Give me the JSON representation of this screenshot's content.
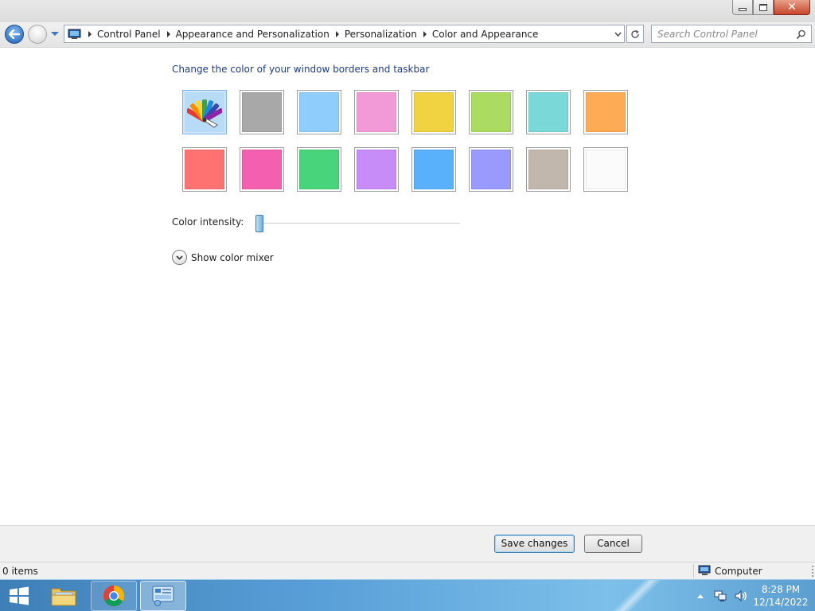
{
  "window": {
    "controls": {
      "minimize": "minimize-icon",
      "maximize": "restore-icon",
      "close": "close-icon"
    }
  },
  "nav": {
    "breadcrumbs": [
      "Control Panel",
      "Appearance and Personalization",
      "Personalization",
      "Color and Appearance"
    ],
    "search_placeholder": "Search Control Panel"
  },
  "main": {
    "heading": "Change the color of your window borders and taskbar",
    "swatches": [
      {
        "name": "custom",
        "color": "#b8dbf8",
        "selected": true,
        "icon": "color-palette-icon"
      },
      {
        "name": "slate",
        "color": "#a8a8a8"
      },
      {
        "name": "sky",
        "color": "#8ecdfc"
      },
      {
        "name": "twilight",
        "color": "#f29ad7"
      },
      {
        "name": "sun",
        "color": "#f1d240"
      },
      {
        "name": "leaf",
        "color": "#abdc61"
      },
      {
        "name": "sea-foam",
        "color": "#7bd8d8"
      },
      {
        "name": "pumpkin",
        "color": "#fdab55"
      },
      {
        "name": "blush",
        "color": "#ff7272"
      },
      {
        "name": "fuchsia",
        "color": "#f45fb0"
      },
      {
        "name": "lime",
        "color": "#47d47b"
      },
      {
        "name": "lavender",
        "color": "#c88cf8"
      },
      {
        "name": "violet-blue",
        "color": "#59b1fc"
      },
      {
        "name": "periwinkle",
        "color": "#9a99fc"
      },
      {
        "name": "taupe",
        "color": "#c2b7ac"
      },
      {
        "name": "frost",
        "color": "#fbfbfb"
      }
    ],
    "intensity_label": "Color intensity:",
    "intensity_value": 0.01,
    "mixer_label": "Show color mixer"
  },
  "buttons": {
    "save": "Save changes",
    "cancel": "Cancel"
  },
  "status": {
    "items": "0 items",
    "location": "Computer"
  },
  "taskbar": {
    "apps": [
      "windows-explorer-icon",
      "chrome-icon",
      "control-panel-icon"
    ],
    "time": "8:28 PM",
    "date": "12/14/2022"
  }
}
